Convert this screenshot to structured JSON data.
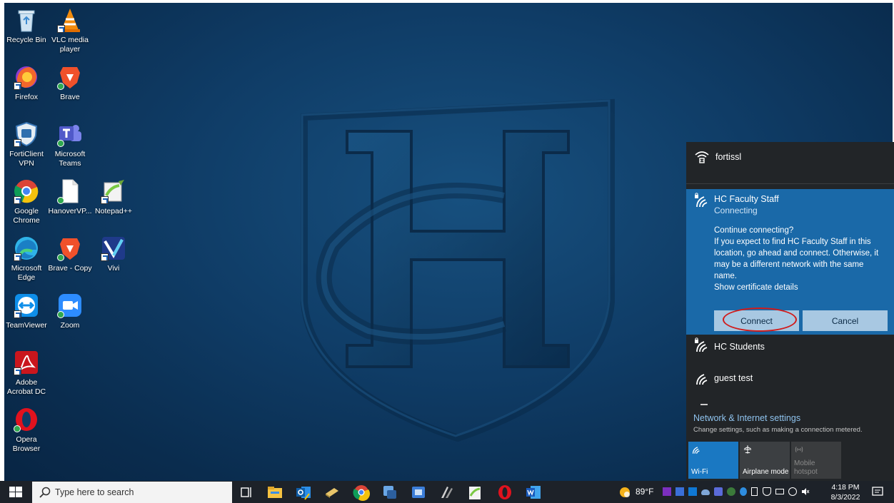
{
  "desktop": {
    "icons": [
      {
        "label": "Recycle Bin",
        "icon": "recycle-bin-icon"
      },
      {
        "label": "VLC media player",
        "icon": "vlc-icon"
      },
      {
        "label": "Firefox",
        "icon": "firefox-icon"
      },
      {
        "label": "Brave",
        "icon": "brave-icon"
      },
      {
        "label": "FortiClient VPN",
        "icon": "forticlient-icon"
      },
      {
        "label": "Microsoft Teams",
        "icon": "teams-icon"
      },
      {
        "label": "Google Chrome",
        "icon": "chrome-icon"
      },
      {
        "label": "HanoverVP...",
        "icon": "document-icon"
      },
      {
        "label": "Notepad++",
        "icon": "notepad-plus-icon"
      },
      {
        "label": "Microsoft Edge",
        "icon": "edge-icon"
      },
      {
        "label": "Brave - Copy",
        "icon": "brave-icon"
      },
      {
        "label": "Vivi",
        "icon": "vivi-icon"
      },
      {
        "label": "TeamViewer",
        "icon": "teamviewer-icon"
      },
      {
        "label": "Zoom",
        "icon": "zoom-icon"
      },
      {
        "label": "Adobe Acrobat DC",
        "icon": "acrobat-icon"
      },
      {
        "label": "Opera Browser",
        "icon": "opera-icon"
      }
    ]
  },
  "wifi_flyout": {
    "networks": [
      {
        "name": "fortissl",
        "status": ""
      },
      {
        "name": "HC Faculty Staff",
        "status": "Connecting"
      },
      {
        "name": "HC Students",
        "status": ""
      },
      {
        "name": "guest test",
        "status": ""
      }
    ],
    "prompt": {
      "title": "Continue connecting?",
      "body": "If you expect to find HC Faculty Staff in this location, go ahead and connect. Otherwise, it may be a different network with the same name.",
      "cert_link": "Show certificate details",
      "connect_label": "Connect",
      "cancel_label": "Cancel"
    },
    "settings_title": "Network & Internet settings",
    "settings_subtitle": "Change settings, such as making a connection metered.",
    "tiles": [
      {
        "label": "Wi-Fi",
        "active": true
      },
      {
        "label": "Airplane mode",
        "active": false
      },
      {
        "label": "Mobile hotspot",
        "active": false,
        "disabled": true
      }
    ]
  },
  "taskbar": {
    "search_placeholder": "Type here to search",
    "apps": [
      "task-view-icon",
      "file-explorer-icon",
      "outlook-icon",
      "sticky-app-icon",
      "chrome-icon",
      "vpn-app-icon",
      "app-icon",
      "snipping-icon",
      "notepad-plus-icon",
      "opera-icon",
      "word-icon"
    ],
    "weather_temp": "89°F",
    "time": "4:18 PM",
    "date": "8/3/2022"
  },
  "colors": {
    "desktop_bg": "#0f3c66",
    "flyout_bg": "#222528",
    "accent": "#1a69a8",
    "taskbar_bg": "#1d2229",
    "highlight_circle": "#d11b1b"
  }
}
